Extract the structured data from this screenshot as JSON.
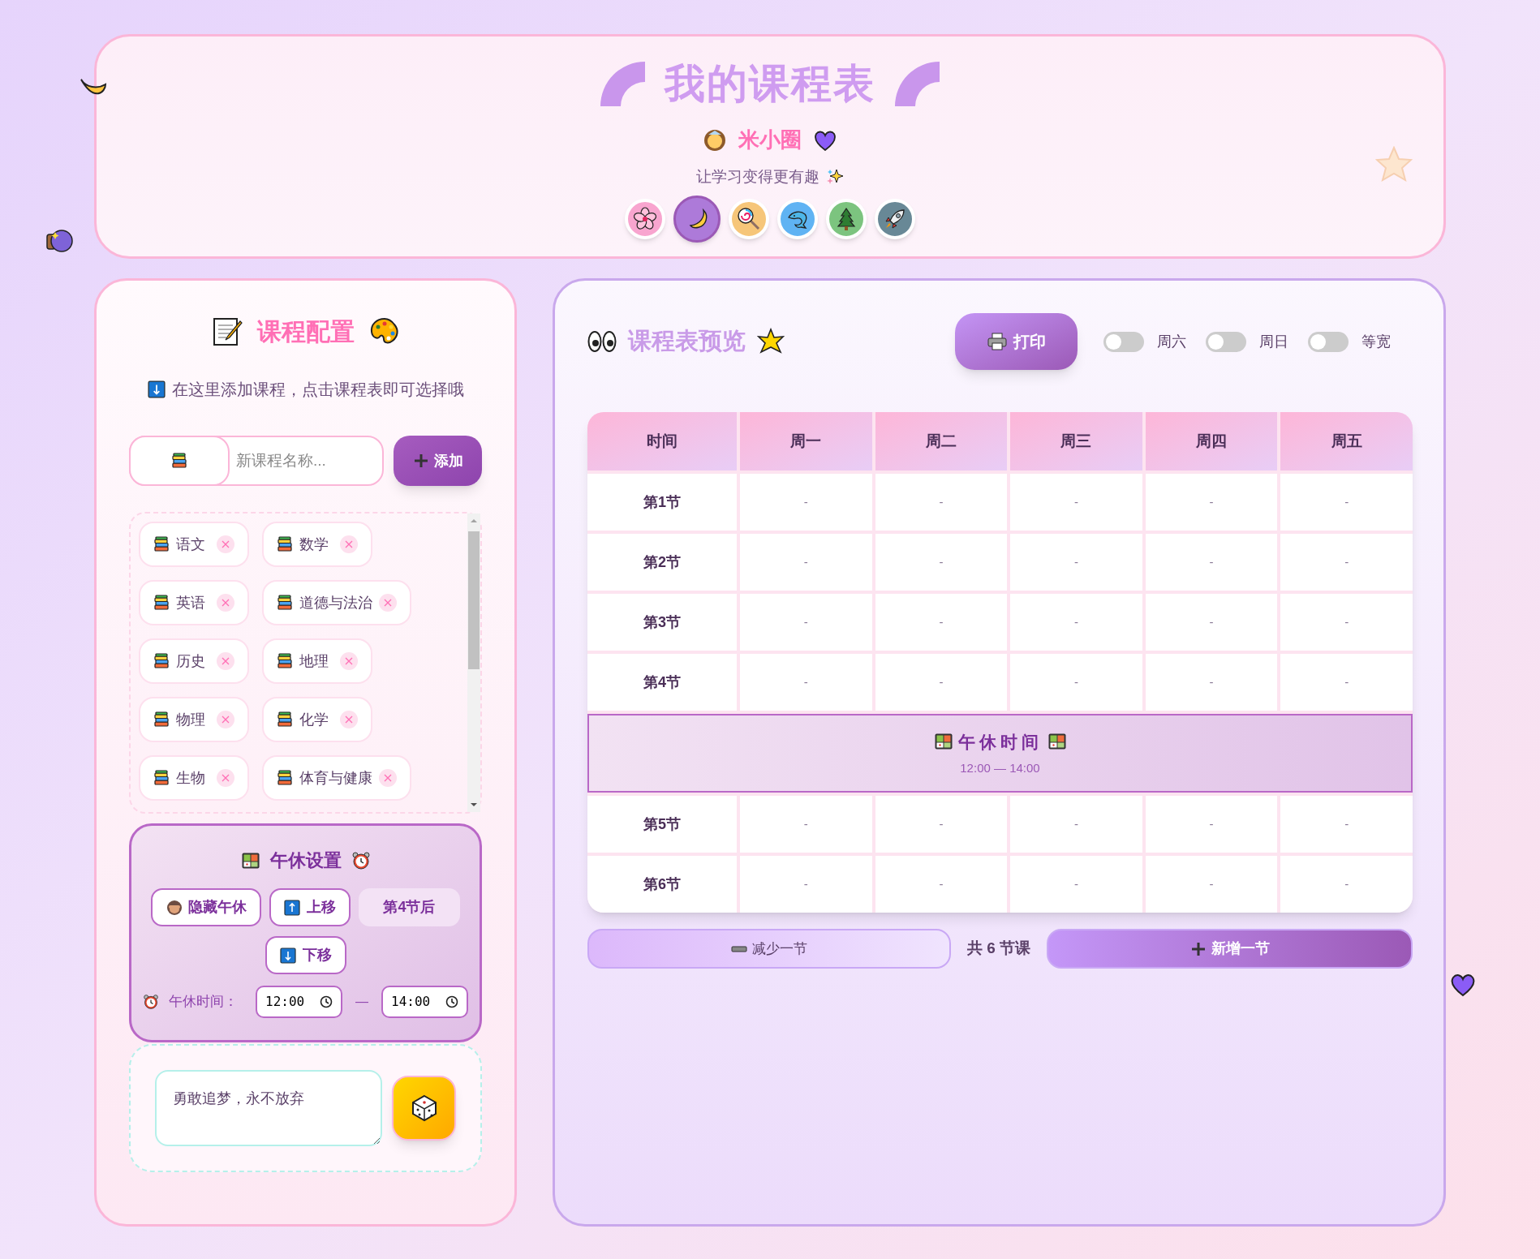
{
  "header": {
    "title": "我的课程表",
    "user_name": "米小圈",
    "subtitle": "让学习变得更有趣",
    "themes": [
      {
        "selected": false,
        "color": "#f8a5cf"
      },
      {
        "selected": true,
        "color": "#ad7ad9"
      },
      {
        "selected": false,
        "color": "#f6c679"
      },
      {
        "selected": false,
        "color": "#5fb3f3"
      },
      {
        "selected": false,
        "color": "#7cc47f"
      },
      {
        "selected": false,
        "color": "#688896"
      }
    ]
  },
  "config": {
    "title": "课程配置",
    "hint": "在这里添加课程，点击课程表即可选择哦",
    "course_input": {
      "placeholder": "新课程名称..."
    },
    "add_button": "添加",
    "courses": [
      "语文",
      "数学",
      "英语",
      "道德与法治",
      "历史",
      "地理",
      "物理",
      "化学",
      "生物",
      "体育与健康"
    ]
  },
  "lunch": {
    "title": "午休设置",
    "hide_button": "隐藏午休",
    "up_button": "上移",
    "position": "第4节后",
    "down_button": "下移",
    "time_label": "午休时间：",
    "start": "12:00",
    "separator": "—",
    "end": "14:00"
  },
  "motto": {
    "value": "勇敢追梦，永不放弃"
  },
  "preview": {
    "title": "课程表预览",
    "print_button": "打印",
    "toggles": [
      {
        "label": "周六",
        "on": false
      },
      {
        "label": "周日",
        "on": false
      },
      {
        "label": "等宽",
        "on": false
      }
    ],
    "columns": [
      "时间",
      "周一",
      "周二",
      "周三",
      "周四",
      "周五"
    ],
    "rows": [
      {
        "kind": "period",
        "label": "第1节",
        "cells": [
          "-",
          "-",
          "-",
          "-",
          "-"
        ]
      },
      {
        "kind": "period",
        "label": "第2节",
        "cells": [
          "-",
          "-",
          "-",
          "-",
          "-"
        ]
      },
      {
        "kind": "period",
        "label": "第3节",
        "cells": [
          "-",
          "-",
          "-",
          "-",
          "-"
        ]
      },
      {
        "kind": "period",
        "label": "第4节",
        "cells": [
          "-",
          "-",
          "-",
          "-",
          "-"
        ]
      },
      {
        "kind": "lunch",
        "title": "午休时间",
        "time": "12:00 — 14:00"
      },
      {
        "kind": "period",
        "label": "第5节",
        "cells": [
          "-",
          "-",
          "-",
          "-",
          "-"
        ]
      },
      {
        "kind": "period",
        "label": "第6节",
        "cells": [
          "-",
          "-",
          "-",
          "-",
          "-"
        ]
      }
    ],
    "remove_button": "减少一节",
    "count": "共 6 节课",
    "add_button": "新增一节"
  }
}
